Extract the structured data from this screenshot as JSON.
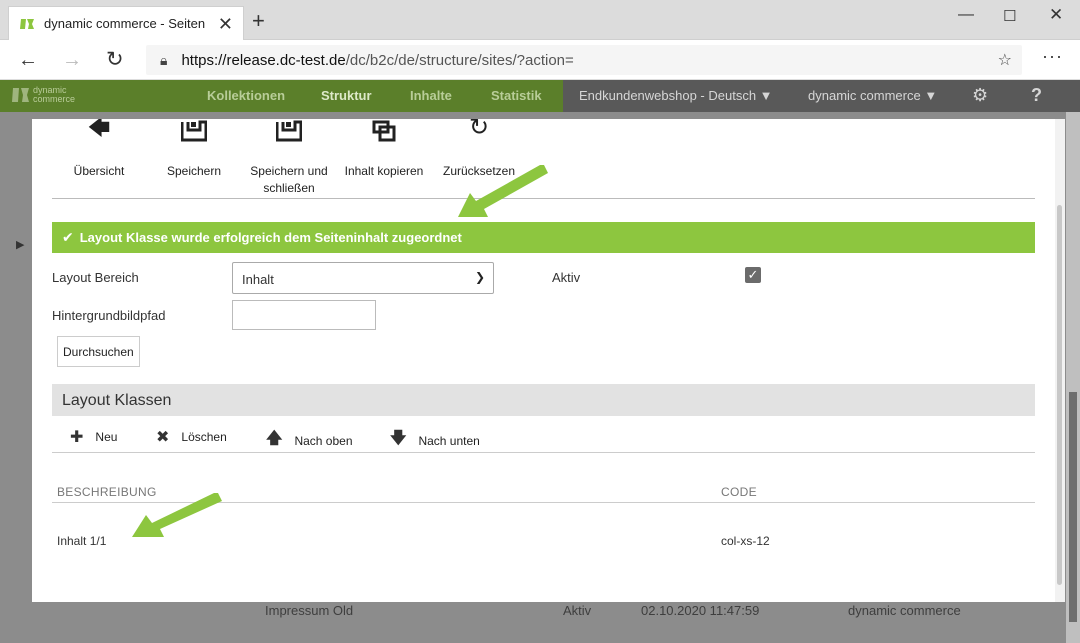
{
  "browser": {
    "tab_title": "dynamic commerce - Seiten",
    "tab_close": "✕",
    "new_tab": "+",
    "url_host": "https://release.dc-test.de",
    "url_path": "/dc/b2c/de/structure/sites/?action="
  },
  "app": {
    "logo_line1": "dynamic",
    "logo_line2": "commerce",
    "nav": [
      "Kollektionen",
      "Struktur",
      "Inhalte",
      "Statistik"
    ],
    "shop_select": "Endkundenwebshop - Deutsch",
    "company_select": "dynamic commerce",
    "help": "?"
  },
  "background_row": {
    "name": "Impressum Old",
    "status": "Aktiv",
    "date": "02.10.2020 11:47:59",
    "owner": "dynamic commerce"
  },
  "toolbar": {
    "overview": "Übersicht",
    "save": "Speichern",
    "save_close_1": "Speichern und",
    "save_close_2": "schließen",
    "copy": "Inhalt kopieren",
    "reset": "Zurücksetzen"
  },
  "message": {
    "success": "Layout Klasse wurde erfolgreich dem Seiteninhalt zugeordnet",
    "color": "#8dc63f"
  },
  "form": {
    "layout_area_label": "Layout Bereich",
    "layout_area_value": "Inhalt",
    "active_label": "Aktiv",
    "active_checked": true,
    "bg_path_label": "Hintergrundbildpfad",
    "bg_path_value": "",
    "browse_button": "Durchsuchen"
  },
  "layout_classes": {
    "title": "Layout Klassen",
    "actions": {
      "new": "Neu",
      "delete": "Löschen",
      "up": "Nach oben",
      "down": "Nach unten"
    },
    "columns": {
      "description": "BESCHREIBUNG",
      "code": "CODE"
    },
    "rows": [
      {
        "description": "Inhalt 1/1",
        "code": "col-xs-12"
      }
    ]
  },
  "colors": {
    "brand_green": "#8dc63f",
    "header_green": "#5b7f2a"
  }
}
